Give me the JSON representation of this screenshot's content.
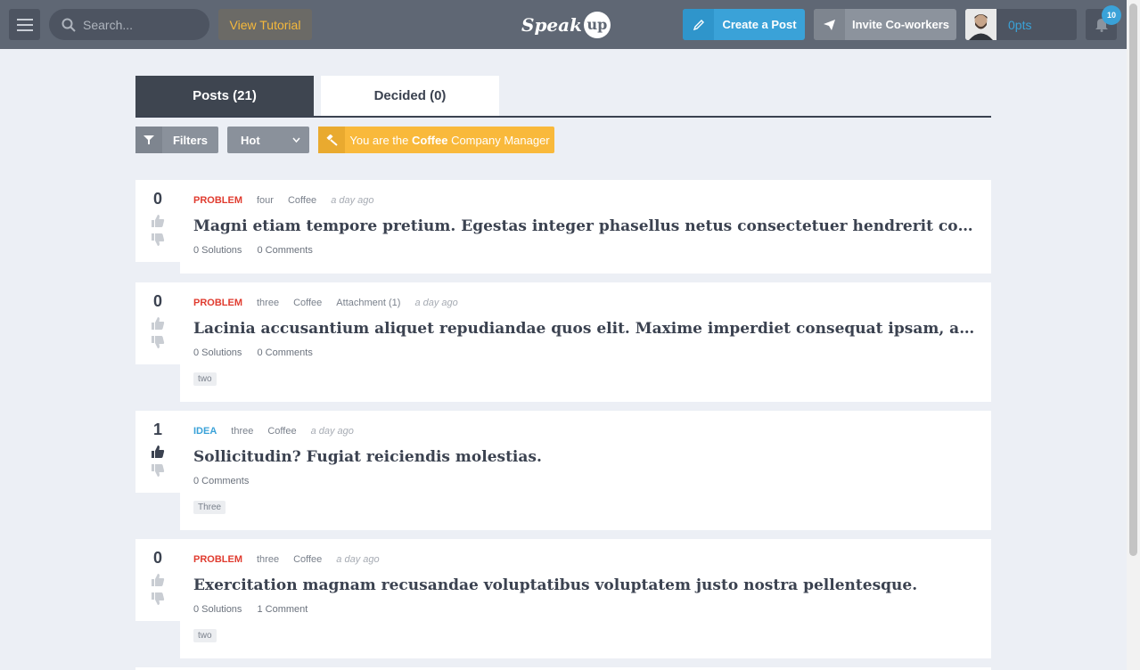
{
  "topbar": {
    "search_placeholder": "Search...",
    "tutorial_label": "View Tutorial",
    "logo_text": "Speak",
    "logo_bubble": "up",
    "create_post_label": "Create a Post",
    "invite_label": "Invite Co-workers",
    "points": "0pts",
    "notification_count": "10"
  },
  "tabs": {
    "posts": "Posts (21)",
    "decided": "Decided (0)"
  },
  "toolbar": {
    "filters_label": "Filters",
    "sort_value": "Hot",
    "manager_prefix": "You are the ",
    "manager_company": "Coffee",
    "manager_suffix": " Company Manager"
  },
  "posts": [
    {
      "votes": "0",
      "type": "PROBLEM",
      "author": "four",
      "company": "Coffee",
      "attachment": "",
      "time": "a day ago",
      "title": "Magni etiam tempore pretium. Egestas integer phasellus netus consectetuer hendrerit convallis dictum",
      "solutions": "0 Solutions",
      "comments": "0 Comments",
      "tag": ""
    },
    {
      "votes": "0",
      "type": "PROBLEM",
      "author": "three",
      "company": "Coffee",
      "attachment": "Attachment (1)",
      "time": "a day ago",
      "title": "Lacinia accusantium aliquet repudiandae quos elit. Maxime imperdiet consequat ipsam, aptent sapiente",
      "solutions": "0 Solutions",
      "comments": "0 Comments",
      "tag": "two"
    },
    {
      "votes": "1",
      "type": "IDEA",
      "author": "three",
      "company": "Coffee",
      "attachment": "",
      "time": "a day ago",
      "title": "Sollicitudin? Fugiat reiciendis molestias.",
      "solutions": "",
      "comments": "0 Comments",
      "tag": "Three"
    },
    {
      "votes": "0",
      "type": "PROBLEM",
      "author": "three",
      "company": "Coffee",
      "attachment": "",
      "time": "a day ago",
      "title": "Exercitation magnam recusandae voluptatibus voluptatem justo nostra pellentesque.",
      "solutions": "0 Solutions",
      "comments": "1 Comment",
      "tag": "two"
    }
  ],
  "colors": {
    "problem": "#e03b2f",
    "idea": "#3aa2d8",
    "accent": "#3aa2d8",
    "manager": "#f9b93b"
  }
}
